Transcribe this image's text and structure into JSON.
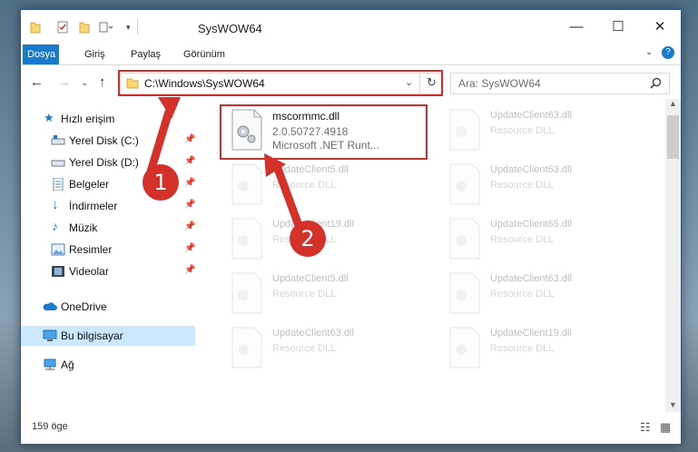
{
  "window": {
    "title": "SysWOW64"
  },
  "ribbon": {
    "tabs": [
      "Dosya",
      "Giriş",
      "Paylaş",
      "Görünüm"
    ]
  },
  "nav": {
    "address": "C:\\Windows\\SysWOW64",
    "search_placeholder": "Ara: SysWOW64"
  },
  "sidebar": {
    "quick_access": "Hızlı erişim",
    "items": [
      {
        "label": "Yerel Disk (C:)",
        "icon": "drive-icon"
      },
      {
        "label": "Yerel Disk (D:)",
        "icon": "drive-icon"
      },
      {
        "label": "Belgeler",
        "icon": "documents-icon"
      },
      {
        "label": "İndirmeler",
        "icon": "download-icon"
      },
      {
        "label": "Müzik",
        "icon": "music-icon"
      },
      {
        "label": "Resimler",
        "icon": "pictures-icon"
      },
      {
        "label": "Videolar",
        "icon": "videos-icon"
      }
    ],
    "onedrive": "OneDrive",
    "this_pc": "Bu bilgisayar",
    "network": "Ağ"
  },
  "files": {
    "main": {
      "name": "mscormmc.dll",
      "version": "2.0.50727.4918",
      "desc": "Microsoft .NET Runt..."
    },
    "ghosts": [
      {
        "name": "UpdateClient63.dll",
        "desc": "Resource DLL"
      },
      {
        "name": "UpdateClient5.dll",
        "desc": "Resource DLL"
      },
      {
        "name": "UpdateClient63.dll",
        "desc": "Resource DLL"
      },
      {
        "name": "UpdateClient19.dll",
        "desc": "Resource DLL"
      },
      {
        "name": "UpdateClient65.dll",
        "desc": "Resource DLL"
      },
      {
        "name": "UpdateClient5.dll",
        "desc": "Resource DLL"
      },
      {
        "name": "UpdateClient63.dll",
        "desc": "Resource DLL"
      },
      {
        "name": "UpdateClient63.dll",
        "desc": "Resource DLL"
      },
      {
        "name": "UpdateClient19.dll",
        "desc": "Resource DLL"
      }
    ]
  },
  "status": {
    "count": "159 öge"
  },
  "annotations": {
    "step1": "1",
    "step2": "2"
  },
  "colors": {
    "accent": "#1979ca",
    "highlight": "#c9302c",
    "selected": "#cce8ff"
  }
}
